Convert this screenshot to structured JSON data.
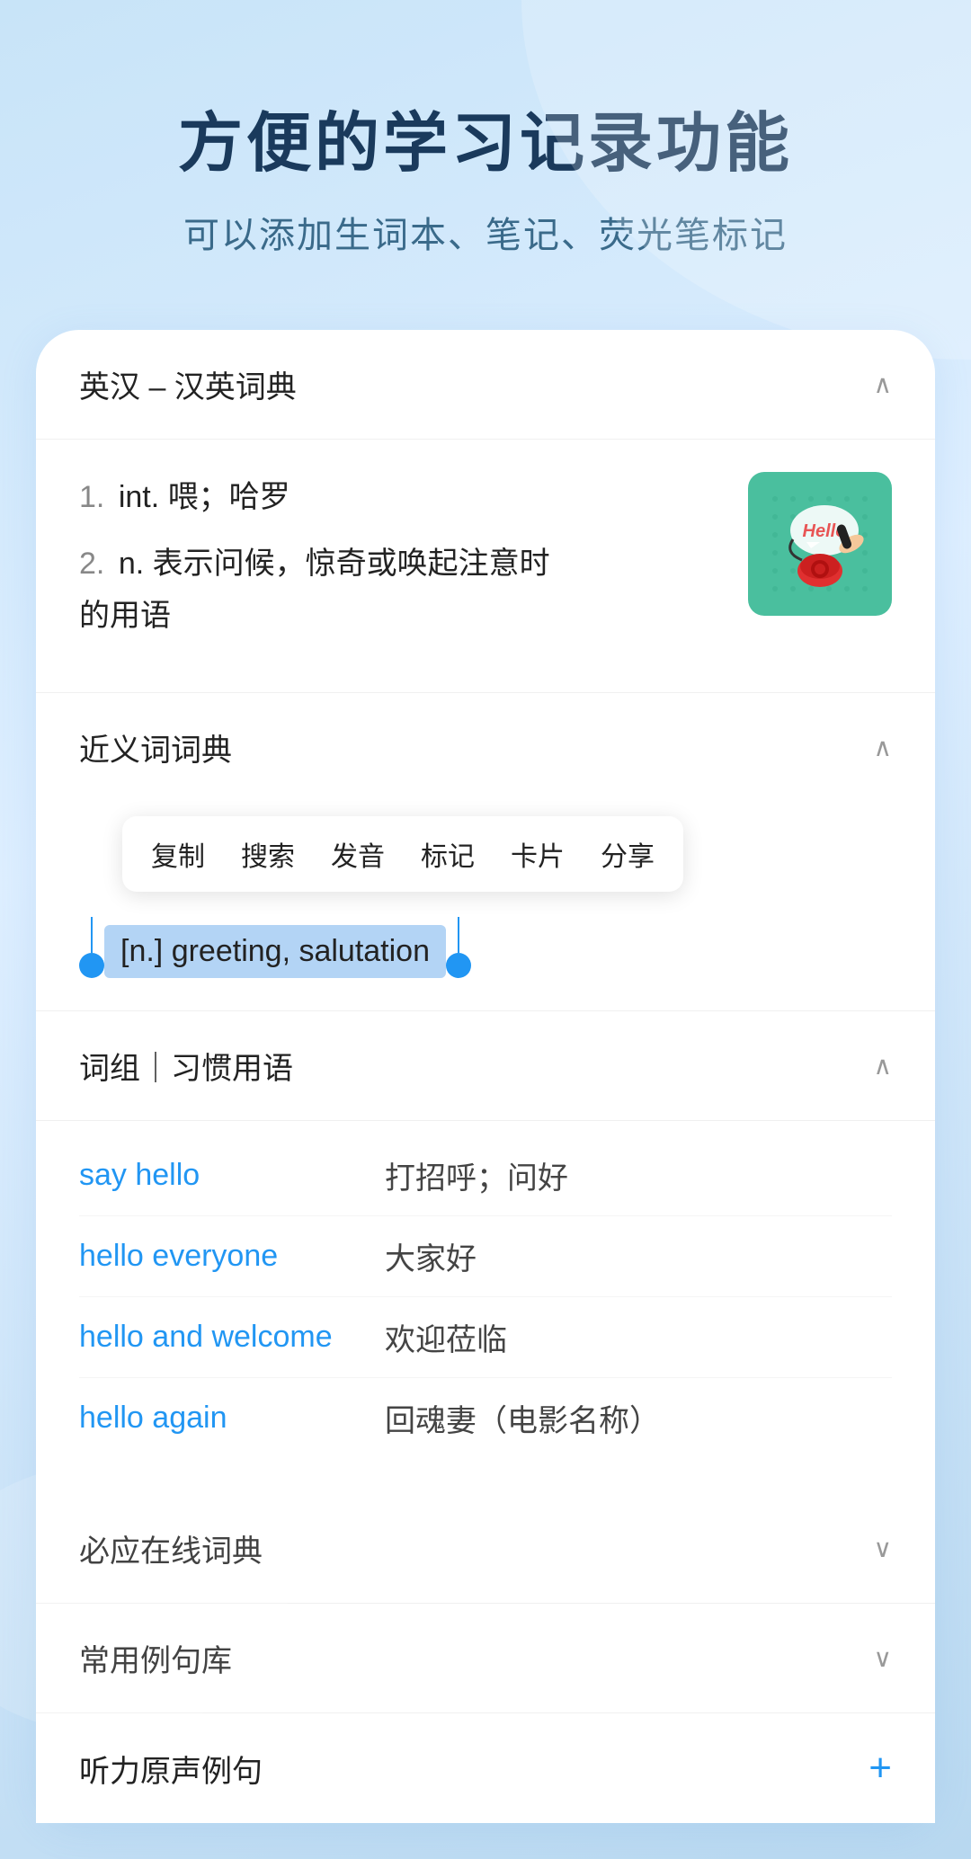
{
  "hero": {
    "title": "方便的学习记录功能",
    "subtitle": "可以添加生词本、笔记、荧光笔标记"
  },
  "sections": {
    "dict": {
      "title": "英汉 – 汉英词典",
      "definitions": [
        {
          "num": "1.",
          "type": "int.",
          "text": "喂；哈罗"
        },
        {
          "num": "2.",
          "type": "n.",
          "text": "表示问候，惊奇或唤起注意时的用语"
        }
      ]
    },
    "synonym": {
      "title": "近义词词典",
      "context_menu": [
        "复制",
        "搜索",
        "发音",
        "标记",
        "卡片",
        "分享"
      ],
      "selected_text": "[n.] greeting, salutation"
    },
    "phrases": {
      "title": "词组｜习惯用语",
      "items": [
        {
          "en": "say hello",
          "zh": "打招呼；问好"
        },
        {
          "en": "hello everyone",
          "zh": "大家好"
        },
        {
          "en": "hello and welcome",
          "zh": "欢迎莅临"
        },
        {
          "en": "hello again",
          "zh": "回魂妻（电影名称）"
        }
      ]
    },
    "collapsed1": {
      "title": "必应在线词典"
    },
    "collapsed2": {
      "title": "常用例句库"
    },
    "collapsed3": {
      "title": "听力原声例句"
    }
  }
}
